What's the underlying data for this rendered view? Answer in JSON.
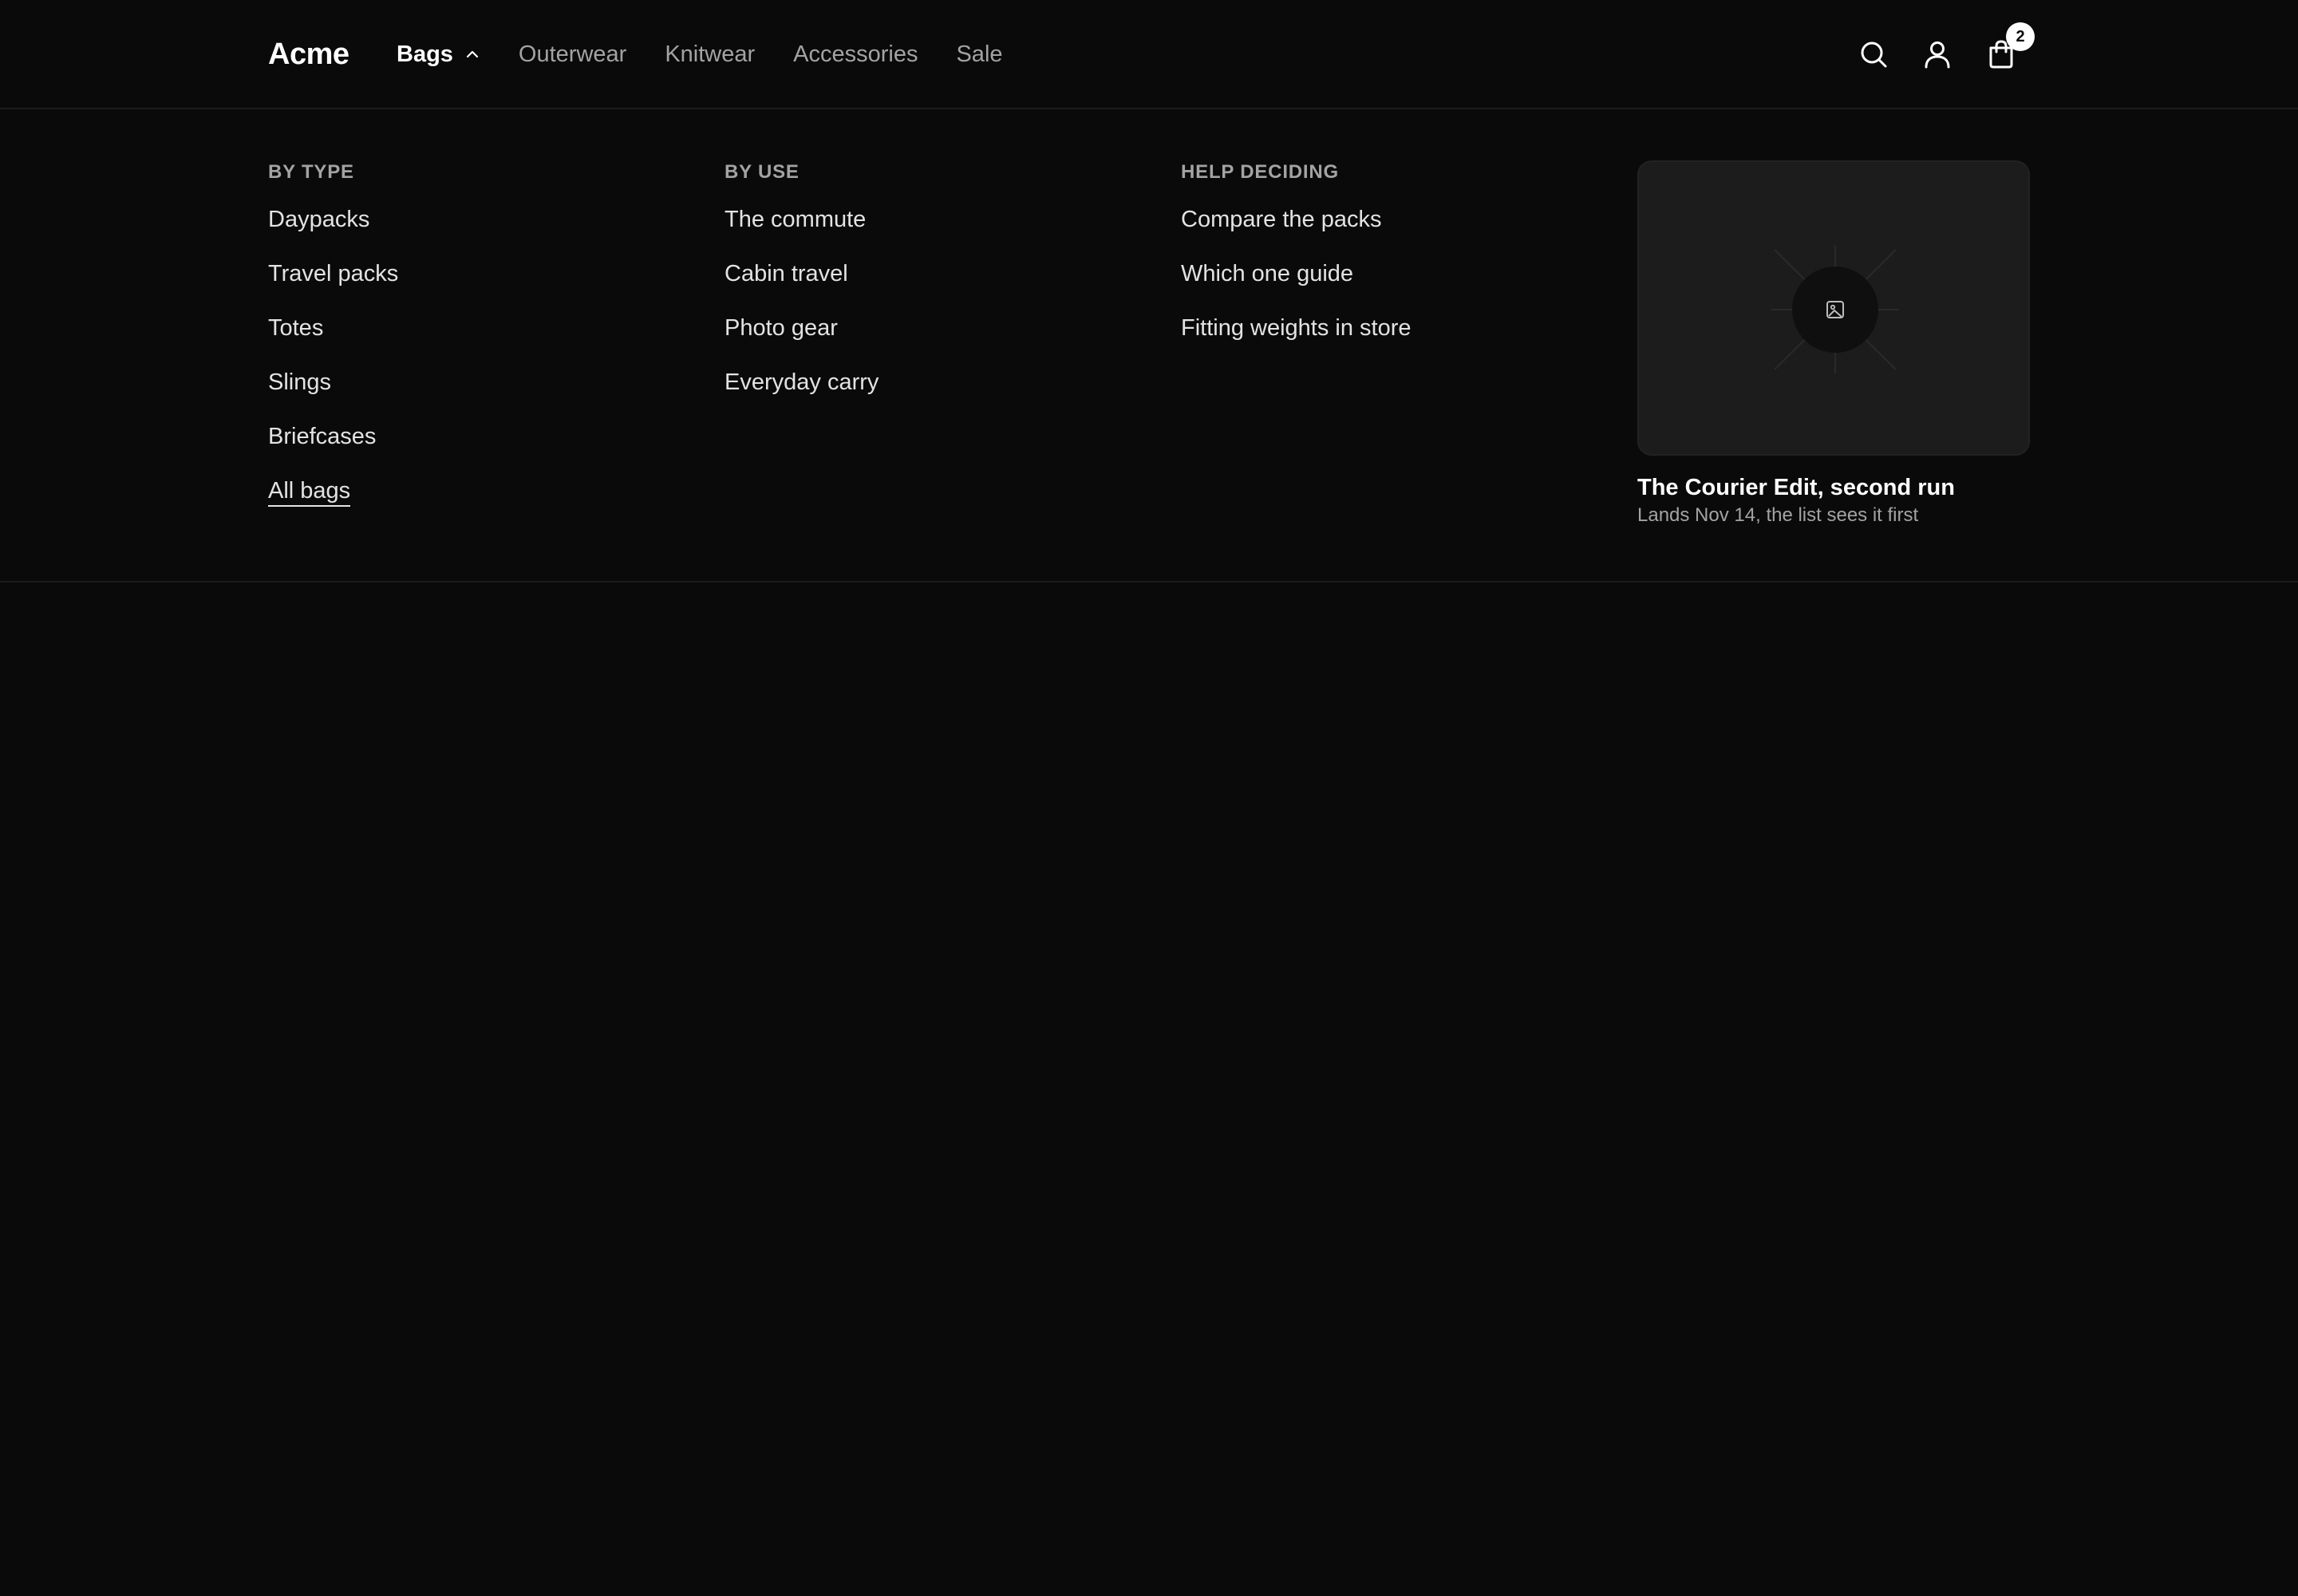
{
  "brand": {
    "name": "Acme"
  },
  "nav": {
    "items": [
      {
        "label": "Bags",
        "active": true,
        "expanded": true
      },
      {
        "label": "Outerwear"
      },
      {
        "label": "Knitwear"
      },
      {
        "label": "Accessories"
      },
      {
        "label": "Sale"
      }
    ]
  },
  "header": {
    "icons": [
      "search-icon",
      "account-icon",
      "cart-icon"
    ],
    "cart_count": "2"
  },
  "mega_menu": {
    "columns": [
      {
        "heading": "BY TYPE",
        "items": [
          "Daypacks",
          "Travel packs",
          "Totes",
          "Slings",
          "Briefcases",
          "All bags"
        ]
      },
      {
        "heading": "BY USE",
        "items": [
          "The commute",
          "Cabin travel",
          "Photo gear",
          "Everyday carry"
        ]
      },
      {
        "heading": "HELP DECIDING",
        "items": [
          "Compare the packs",
          "Which one guide",
          "Fitting weights in store"
        ]
      }
    ],
    "promo": {
      "title": "The Courier Edit, second run",
      "subtitle": "Lands Nov 14, the list sees it first",
      "image_icon": "image-placeholder-icon"
    }
  },
  "colors": {
    "background": "#0a0a0a",
    "text_primary": "#ffffff",
    "text_secondary": "#a3a3a3",
    "badge": "#ffffff"
  }
}
